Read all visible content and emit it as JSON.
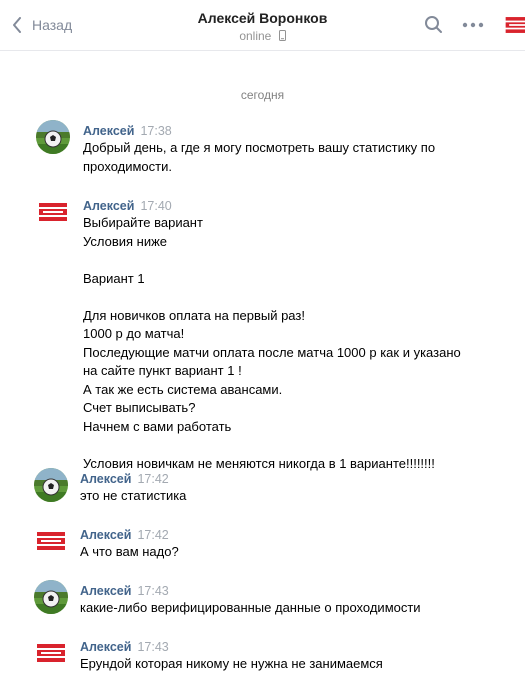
{
  "header": {
    "back_label": "Назад",
    "contact_name": "Алексей Воронков",
    "status": "online"
  },
  "date_divider": "сегодня",
  "messages": [
    {
      "author": "Алексей",
      "time": "17:38",
      "avatar": "football",
      "text": "Добрый день, а где я могу посмотреть вашу статистику по\nпроходимости."
    },
    {
      "author": "Алексей",
      "time": "17:40",
      "avatar": "logo",
      "text": "Выбирайте вариант\nУсловия ниже\n\nВариант 1\n\nДля новичков оплата на первый раз!\n1000 р до матча!\nПоследующие матчи оплата после матча 1000 р как и указано\nна сайте пункт вариант 1 !\nА так же есть система авансами.\nСчет выписывать?\nНачнем с вами работать\n\nУсловия новичкам не меняются никогда в 1 варианте!!!!!!!!"
    },
    {
      "author": "Алексей",
      "time": "17:42",
      "avatar": "football",
      "text": "это не статистика"
    },
    {
      "author": "Алексей",
      "time": "17:42",
      "avatar": "logo",
      "text": "А что вам надо?"
    },
    {
      "author": "Алексей",
      "time": "17:43",
      "avatar": "football",
      "text": "какие-либо верифицированные данные о проходимости"
    },
    {
      "author": "Алексей",
      "time": "17:43",
      "avatar": "logo",
      "text": "Ерундой которая никому не нужна не занимаемся"
    }
  ]
}
